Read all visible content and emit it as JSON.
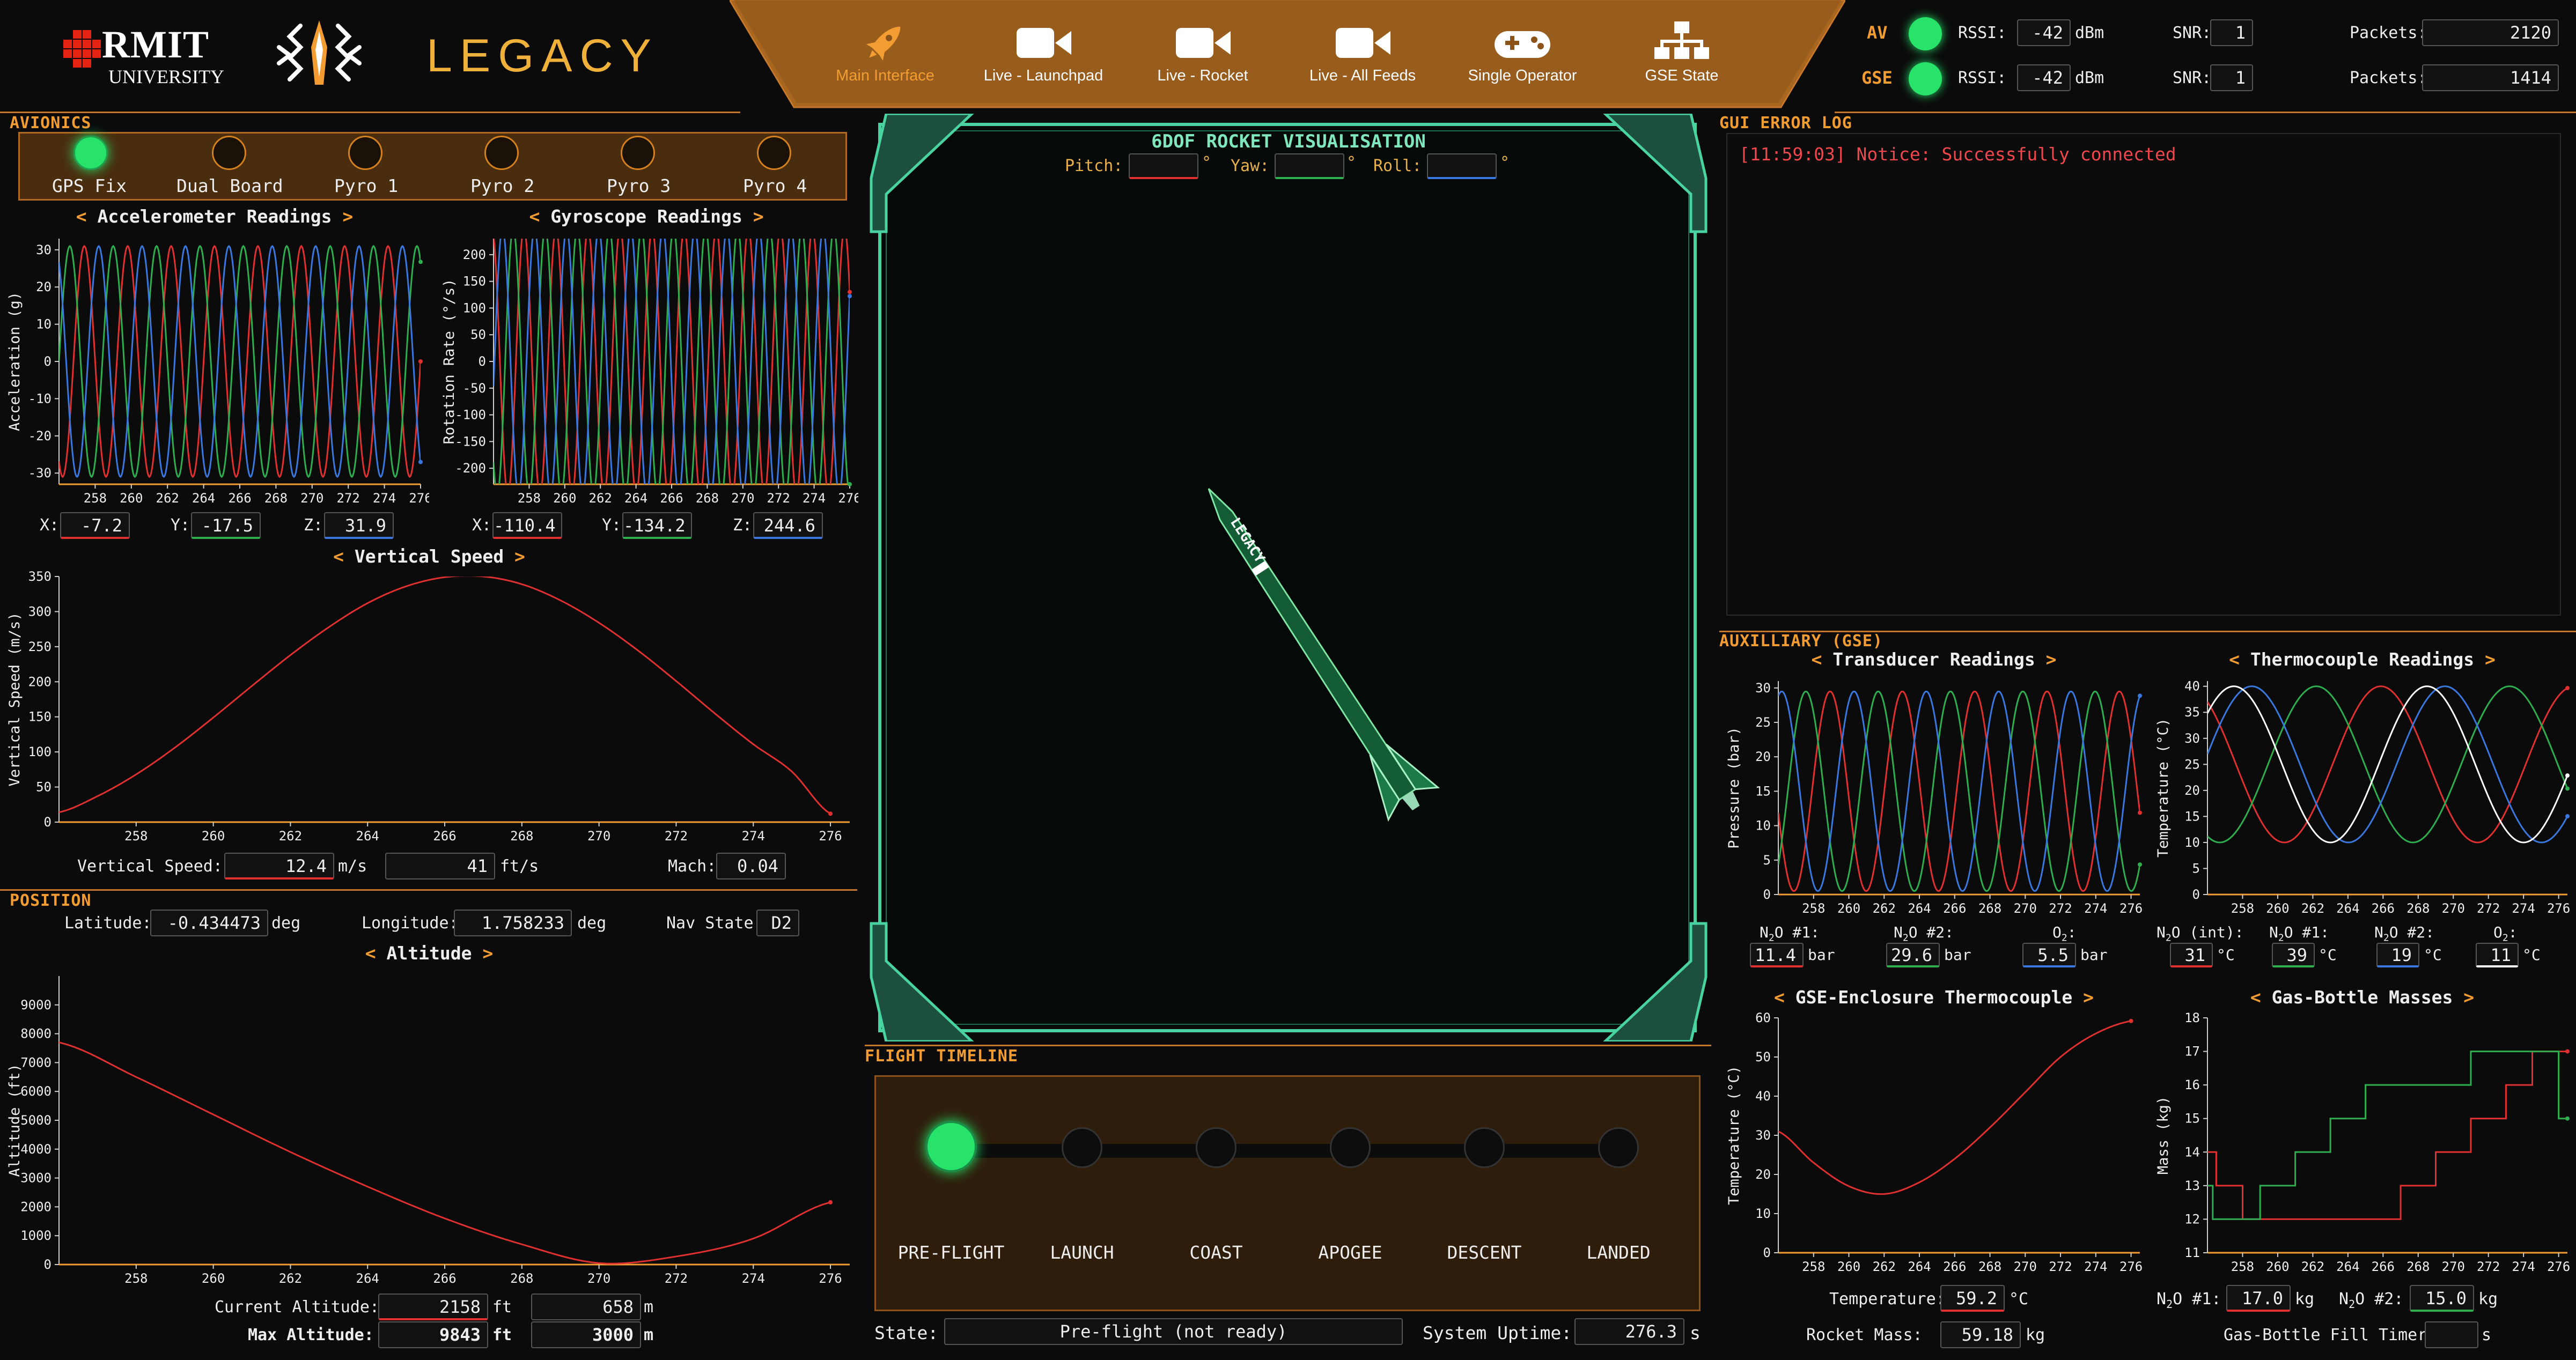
{
  "header": {
    "logo_rmit": "RMIT",
    "logo_university": "UNIVERSITY",
    "logo_legacy": "LEGACY",
    "nav": [
      {
        "label": "Main Interface",
        "icon": "rocket-icon"
      },
      {
        "label": "Live - Launchpad",
        "icon": "video-camera-icon"
      },
      {
        "label": "Live - Rocket",
        "icon": "video-camera-icon"
      },
      {
        "label": "Live - All Feeds",
        "icon": "video-camera-icon"
      },
      {
        "label": "Single Operator",
        "icon": "gamepad-icon"
      },
      {
        "label": "GSE State",
        "icon": "network-icon"
      }
    ],
    "status": [
      {
        "name": "AV",
        "rssi_label": "RSSI:",
        "rssi": "-42",
        "rssi_unit": "dBm",
        "snr_label": "SNR:",
        "snr": "1",
        "packets_label": "Packets:",
        "packets": "2120"
      },
      {
        "name": "GSE",
        "rssi_label": "RSSI:",
        "rssi": "-42",
        "rssi_unit": "dBm",
        "snr_label": "SNR:",
        "snr": "1",
        "packets_label": "Packets:",
        "packets": "1414"
      }
    ]
  },
  "avionics": {
    "title": "AVIONICS",
    "indicators": [
      {
        "label": "GPS Fix",
        "on": true
      },
      {
        "label": "Dual Board",
        "on": false
      },
      {
        "label": "Pyro 1",
        "on": false
      },
      {
        "label": "Pyro 2",
        "on": false
      },
      {
        "label": "Pyro 3",
        "on": false
      },
      {
        "label": "Pyro 4",
        "on": false
      }
    ],
    "accel": {
      "title": "Accelerometer Readings",
      "x_label": "X:",
      "x": "-7.2",
      "y_label": "Y:",
      "y": "-17.5",
      "z_label": "Z:",
      "z": "31.9"
    },
    "gyro": {
      "title": "Gyroscope Readings",
      "x_label": "X:",
      "x": "-110.4",
      "y_label": "Y:",
      "y": "-134.2",
      "z_label": "Z:",
      "z": "244.6"
    },
    "vspeed": {
      "title": "Vertical Speed",
      "label": "Vertical Speed:",
      "ms": "12.4",
      "ms_unit": "m/s",
      "fts": "41",
      "fts_unit": "ft/s",
      "mach_label": "Mach:",
      "mach": "0.04"
    }
  },
  "position": {
    "title": "POSITION",
    "lat_label": "Latitude:",
    "lat": "-0.434473",
    "lat_unit": "deg",
    "lon_label": "Longitude:",
    "lon": "1.758233",
    "lon_unit": "deg",
    "nav_label": "Nav State:",
    "nav": "D2",
    "alt_title": "Altitude",
    "cur_label": "Current Altitude:",
    "cur_ft": "2158",
    "cur_m": "658",
    "max_label": "Max Altitude:",
    "max_ft": "9843",
    "max_m": "3000",
    "ft": "ft",
    "m": "m"
  },
  "viz": {
    "title": "6DOF ROCKET VISUALISATION",
    "pitch_label": "Pitch:",
    "yaw_label": "Yaw:",
    "roll_label": "Roll:",
    "deg": "°",
    "rocket_text": "LEGACY"
  },
  "timeline": {
    "title": "FLIGHT TIMELINE",
    "stages": [
      "PRE-FLIGHT",
      "LAUNCH",
      "COAST",
      "APOGEE",
      "DESCENT",
      "LANDED"
    ],
    "state_label": "State:",
    "state": "Pre-flight (not ready)",
    "uptime_label": "System Uptime:",
    "uptime": "276.3",
    "uptime_unit": "s"
  },
  "errorlog": {
    "title": "GUI ERROR LOG",
    "entries": [
      "[11:59:03] Notice: Successfully connected"
    ]
  },
  "gse": {
    "title": "AUXILLIARY (GSE)",
    "transducer": {
      "title": "Transducer Readings",
      "l1": "#1:",
      "v1": "11.4",
      "l2": "#2:",
      "v2": "29.6",
      "l3": "O",
      "v3": "5.5",
      "unit": "bar"
    },
    "thermo": {
      "title": "Thermocouple Readings",
      "l0": "(int):",
      "v0": "31",
      "l1": "#1:",
      "v1": "39",
      "l2": "#2:",
      "v2": "19",
      "l3": "O",
      "v3": "11",
      "unit": "°C"
    },
    "enclosure": {
      "title": "GSE-Enclosure Thermocouple",
      "temp_label": "Temperature:",
      "temp": "59.2",
      "temp_unit": "°C",
      "mass_label": "Rocket Mass:",
      "mass": "59.18",
      "mass_unit": "kg"
    },
    "masses": {
      "title": "Gas-Bottle Masses",
      "l1": "#1:",
      "v1": "17.0",
      "l2": "#2:",
      "v2": "15.0",
      "unit": "kg",
      "timer_label": "Gas-Bottle Fill Timer:",
      "timer": "",
      "timer_unit": "s"
    },
    "n2o": "N",
    "sub2": "2",
    "o": "O"
  },
  "chart_data": [
    {
      "id": "accel",
      "type": "line",
      "title": "Accelerometer Readings",
      "ylabel": "Acceleration (g)",
      "xlim": [
        256,
        276
      ],
      "ylim": [
        -33,
        33
      ],
      "xticks": [
        258,
        260,
        262,
        264,
        266,
        268,
        270,
        272,
        274,
        276
      ],
      "yticks": [
        30,
        20,
        10,
        0,
        -10,
        -20,
        -30
      ],
      "series": [
        {
          "color": "#e03030",
          "amp": 31,
          "period": 2.4,
          "phase": 0.0,
          "end": -7.2
        },
        {
          "color": "#2fae4f",
          "amp": 31,
          "period": 2.4,
          "phase": 2.1,
          "end": -17.5
        },
        {
          "color": "#3a78e0",
          "amp": 31,
          "period": 2.4,
          "phase": 4.2,
          "end": 31.9
        }
      ]
    },
    {
      "id": "gyro",
      "type": "line",
      "title": "Gyroscope Readings",
      "ylabel": "Rotation Rate (°/s)",
      "xlim": [
        256,
        276
      ],
      "ylim": [
        -230,
        230
      ],
      "xticks": [
        258,
        260,
        262,
        264,
        266,
        268,
        270,
        272,
        274,
        276
      ],
      "yticks": [
        200,
        150,
        100,
        50,
        0,
        -50,
        -100,
        -150,
        -200
      ],
      "series": [
        {
          "color": "#e03030",
          "amp": 250,
          "period": 1.8,
          "phase": 0.5
        },
        {
          "color": "#2fae4f",
          "amp": 250,
          "period": 1.8,
          "phase": 2.6
        },
        {
          "color": "#3a78e0",
          "amp": 250,
          "period": 1.8,
          "phase": 4.7
        }
      ]
    },
    {
      "id": "vspeed",
      "type": "line",
      "title": "Vertical Speed",
      "ylabel": "Vertical Speed (m/s)",
      "xlim": [
        256,
        276.5
      ],
      "ylim": [
        0,
        350
      ],
      "xticks": [
        258,
        260,
        262,
        264,
        266,
        268,
        270,
        272,
        274,
        276
      ],
      "yticks": [
        350,
        300,
        250,
        200,
        150,
        100,
        50,
        0
      ],
      "x": [
        256,
        257,
        258,
        259,
        260,
        261,
        262,
        263,
        264,
        265,
        266,
        267,
        268,
        269,
        270,
        271,
        272,
        273,
        274,
        275,
        276
      ],
      "values": [
        14,
        37,
        68,
        106,
        149,
        194,
        238,
        278,
        312,
        336,
        349,
        350,
        339,
        316,
        284,
        245,
        201,
        155,
        111,
        72,
        12
      ],
      "color": "#e03030"
    },
    {
      "id": "altitude",
      "type": "line",
      "title": "Altitude",
      "ylabel": "Altitude (ft)",
      "xlim": [
        256,
        276.5
      ],
      "ylim": [
        0,
        10000
      ],
      "xticks": [
        258,
        260,
        262,
        264,
        266,
        268,
        270,
        272,
        274,
        276
      ],
      "yticks": [
        9000,
        8000,
        7000,
        6000,
        5000,
        4000,
        3000,
        2000,
        1000,
        0
      ],
      "x": [
        256,
        258,
        260,
        262,
        264,
        266,
        268,
        270,
        272,
        274,
        276
      ],
      "values": [
        7700,
        6500,
        5200,
        3900,
        2700,
        1600,
        700,
        50,
        280,
        900,
        2158
      ],
      "color": "#e03030"
    },
    {
      "id": "transducer",
      "type": "line",
      "title": "Transducer Readings",
      "ylabel": "Pressure (bar)",
      "xlim": [
        256,
        276.5
      ],
      "ylim": [
        0,
        31
      ],
      "xticks": [
        258,
        260,
        262,
        264,
        266,
        268,
        270,
        272,
        274,
        276
      ],
      "yticks": [
        30,
        25,
        20,
        15,
        10,
        5,
        0
      ],
      "series": [
        {
          "color": "#e03030",
          "amp": 14.5,
          "mid": 15,
          "period": 4.1,
          "phase": 0.6
        },
        {
          "color": "#2fae4f",
          "amp": 14.5,
          "mid": 15,
          "period": 4.1,
          "phase": 2.7
        },
        {
          "color": "#3a78e0",
          "amp": 14.5,
          "mid": 15,
          "period": 4.1,
          "phase": 4.8
        }
      ]
    },
    {
      "id": "thermo",
      "type": "line",
      "title": "Thermocouple Readings",
      "ylabel": "Temperature (°C)",
      "xlim": [
        256,
        276.5
      ],
      "ylim": [
        0,
        41
      ],
      "xticks": [
        258,
        260,
        262,
        264,
        266,
        268,
        270,
        272,
        274,
        276
      ],
      "yticks": [
        40,
        35,
        30,
        25,
        20,
        15,
        10,
        5,
        0
      ],
      "series": [
        {
          "color": "#e03030",
          "amp": 15,
          "mid": 25,
          "period": 11.0,
          "phase": 0.5
        },
        {
          "color": "#2fae4f",
          "amp": 15,
          "mid": 25,
          "period": 11.0,
          "phase": 2.6
        },
        {
          "color": "#3a78e0",
          "amp": 15,
          "mid": 25,
          "period": 11.0,
          "phase": 4.7
        },
        {
          "color": "#ffffff",
          "amp": 15,
          "mid": 25,
          "period": 11.0,
          "phase": -1.0
        }
      ]
    },
    {
      "id": "enclosure",
      "type": "line",
      "title": "GSE-Enclosure Thermocouple",
      "ylabel": "Temperature (°C)",
      "xlim": [
        256,
        276.5
      ],
      "ylim": [
        0,
        60
      ],
      "xticks": [
        258,
        260,
        262,
        264,
        266,
        268,
        270,
        272,
        274,
        276
      ],
      "yticks": [
        60,
        50,
        40,
        30,
        20,
        10,
        0
      ],
      "x": [
        256,
        258,
        260,
        262,
        264,
        266,
        268,
        270,
        272,
        274,
        276
      ],
      "values": [
        31,
        23,
        17,
        15,
        18,
        24,
        32,
        41,
        50,
        56,
        59.2
      ],
      "color": "#e03030"
    },
    {
      "id": "masses",
      "type": "line",
      "title": "Gas-Bottle Masses",
      "ylabel": "Mass (kg)",
      "xlim": [
        256,
        276.5
      ],
      "ylim": [
        11,
        18
      ],
      "xticks": [
        258,
        260,
        262,
        264,
        266,
        268,
        270,
        272,
        274,
        276
      ],
      "yticks": [
        18,
        17,
        16,
        15,
        14,
        13,
        12,
        11
      ],
      "series": [
        {
          "color": "#e03030",
          "step": true,
          "x": [
            256,
            256.5,
            257.8,
            258,
            258.3,
            262,
            266,
            267,
            268,
            269,
            270,
            271,
            272,
            273,
            274,
            274.5,
            275,
            276.5
          ],
          "values": [
            14,
            13,
            13,
            12,
            12,
            12,
            12,
            13,
            13,
            14,
            14,
            15,
            15,
            16,
            16,
            17,
            17,
            17
          ]
        },
        {
          "color": "#2fae4f",
          "step": true,
          "x": [
            256,
            256.3,
            258.8,
            259,
            260,
            261,
            262,
            263,
            264,
            265,
            266,
            271,
            272,
            274.5,
            276,
            276.5
          ],
          "values": [
            13,
            12,
            12,
            13,
            13,
            14,
            14,
            15,
            15,
            16,
            16,
            17,
            17,
            17,
            15,
            15
          ]
        }
      ]
    }
  ]
}
